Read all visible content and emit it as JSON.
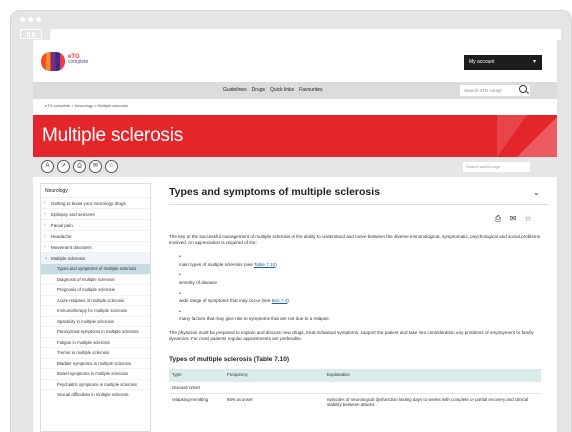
{
  "site": {
    "logo_top": "eTG",
    "logo_bottom": "complete"
  },
  "header": {
    "my_account": "My account",
    "nav": [
      "Guidelines",
      "Drugs",
      "Quick links",
      "Favourites"
    ],
    "search_placeholder": "Search eTG compl"
  },
  "breadcrumb": "eTG complete > Neurology > Multiple sclerosis",
  "banner_title": "Multiple sclerosis",
  "toolbar": {
    "search_page_placeholder": "Search within page"
  },
  "sidebar": {
    "title": "Neurology",
    "items": [
      "Getting to know your neurology drugs",
      "Epilepsy and seizures",
      "Facial pain",
      "Headache",
      "Movement disorders",
      "Multiple sclerosis"
    ],
    "subitems": [
      "Types and symptoms of multiple sclerosis",
      "Diagnosis of multiple sclerosis",
      "Prognosis of multiple sclerosis",
      "Acute relapses of multiple sclerosis",
      "Immunotherapy for multiple sclerosis",
      "Spasticity in multiple sclerosis",
      "Paroxysmal symptoms in multiple sclerosis",
      "Fatigue in multiple sclerosis",
      "Tremor in multiple sclerosis",
      "Bladder symptoms in multiple sclerosis",
      "Bowel symptoms in multiple sclerosis",
      "Psychiatric symptoms in multiple sclerosis",
      "Sexual difficulties in multiple sclerosis"
    ]
  },
  "main": {
    "heading": "Types and symptoms of multiple sclerosis",
    "intro": "The key to the successful management of multiple sclerosis is the ability to understand and move between the diverse immunological, symptomatic, psychological and social problems involved. An appreciation is required of the:",
    "bullets": [
      {
        "text": "main types of multiple sclerosis (see ",
        "link": "Table 7.10",
        "after": ")"
      },
      {
        "text": "severity of disease",
        "link": "",
        "after": ""
      },
      {
        "text": "wide range of symptoms that may occur (see ",
        "link": "Box 7.4",
        "after": ")"
      },
      {
        "text": "many factors that may give rise to symptoms that are not due to a relapse.",
        "link": "",
        "after": ""
      }
    ],
    "para2": "The physician must be prepared to explain and discuss new drugs, treat individual symptoms, support the patient and take into consideration any problems of employment or family dynamics. For most patients regular appointments are preferable.",
    "table_title": "Types of multiple sclerosis (Table 7.10)",
    "table": {
      "headers": [
        "Type",
        "Frequency",
        "Explanation"
      ],
      "section": "Disease onset",
      "rows": [
        [
          "relapsing-remitting",
          "85% at onset",
          "episodes of neurological dysfunction lasting days to weeks with complete or partial recovery and clinical stability between attacks"
        ]
      ]
    }
  }
}
